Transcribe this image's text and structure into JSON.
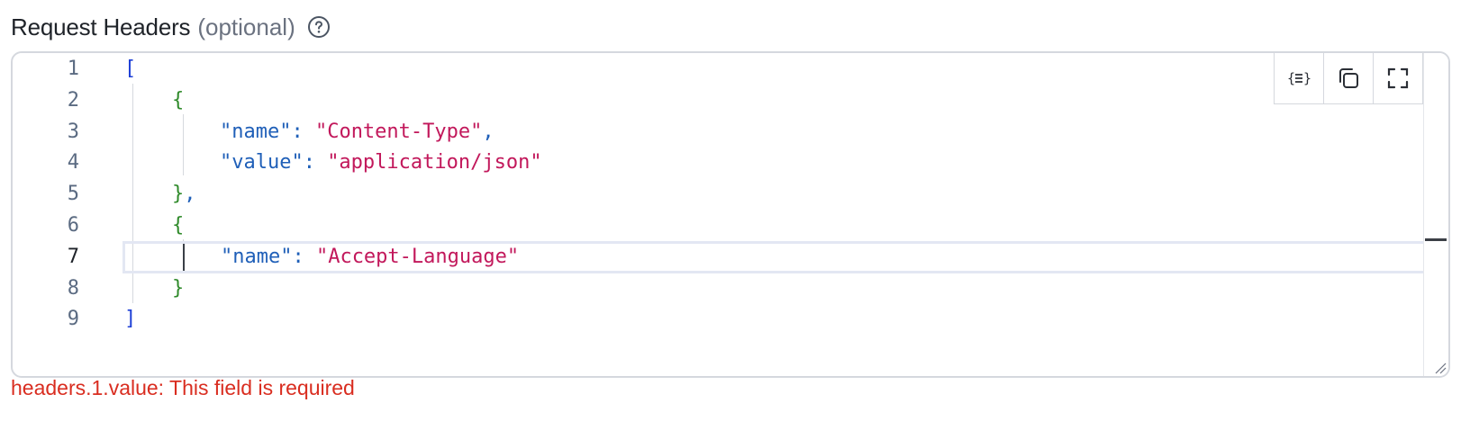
{
  "field": {
    "label": "Request Headers",
    "optional": "(optional)",
    "help_icon": "question-circle-icon"
  },
  "editor": {
    "active_line": 7,
    "line_numbers": [
      "1",
      "2",
      "3",
      "4",
      "5",
      "6",
      "7",
      "8",
      "9"
    ],
    "lines": [
      [
        {
          "t": "[",
          "c": "bracket-blue"
        }
      ],
      [
        {
          "t": "    ",
          "c": ""
        },
        {
          "t": "{",
          "c": "bracket-green"
        }
      ],
      [
        {
          "t": "        ",
          "c": ""
        },
        {
          "t": "\"name\"",
          "c": "key"
        },
        {
          "t": ": ",
          "c": "punct"
        },
        {
          "t": "\"Content-Type\"",
          "c": "str"
        },
        {
          "t": ",",
          "c": "punct"
        }
      ],
      [
        {
          "t": "        ",
          "c": ""
        },
        {
          "t": "\"value\"",
          "c": "key"
        },
        {
          "t": ": ",
          "c": "punct"
        },
        {
          "t": "\"application/json\"",
          "c": "str"
        }
      ],
      [
        {
          "t": "    ",
          "c": ""
        },
        {
          "t": "}",
          "c": "bracket-green"
        },
        {
          "t": ",",
          "c": "punct"
        }
      ],
      [
        {
          "t": "    ",
          "c": ""
        },
        {
          "t": "{",
          "c": "bracket-green"
        }
      ],
      [
        {
          "t": "        ",
          "c": ""
        },
        {
          "t": "\"name\"",
          "c": "key"
        },
        {
          "t": ": ",
          "c": "punct"
        },
        {
          "t": "\"Accept-Language\"",
          "c": "str"
        }
      ],
      [
        {
          "t": "    ",
          "c": ""
        },
        {
          "t": "}",
          "c": "bracket-green"
        }
      ],
      [
        {
          "t": "]",
          "c": "bracket-blue"
        }
      ]
    ],
    "toolbar": {
      "format_icon": "format-json-icon",
      "copy_icon": "copy-icon",
      "fullscreen_icon": "fullscreen-icon"
    }
  },
  "validation": {
    "error": "headers.1.value: This field is required"
  },
  "colors": {
    "error": "#d92d20",
    "key": "#1f5fb8",
    "string": "#c2185b",
    "bracket_outer": "#1d3fd6",
    "bracket_inner": "#2f8a2a"
  }
}
